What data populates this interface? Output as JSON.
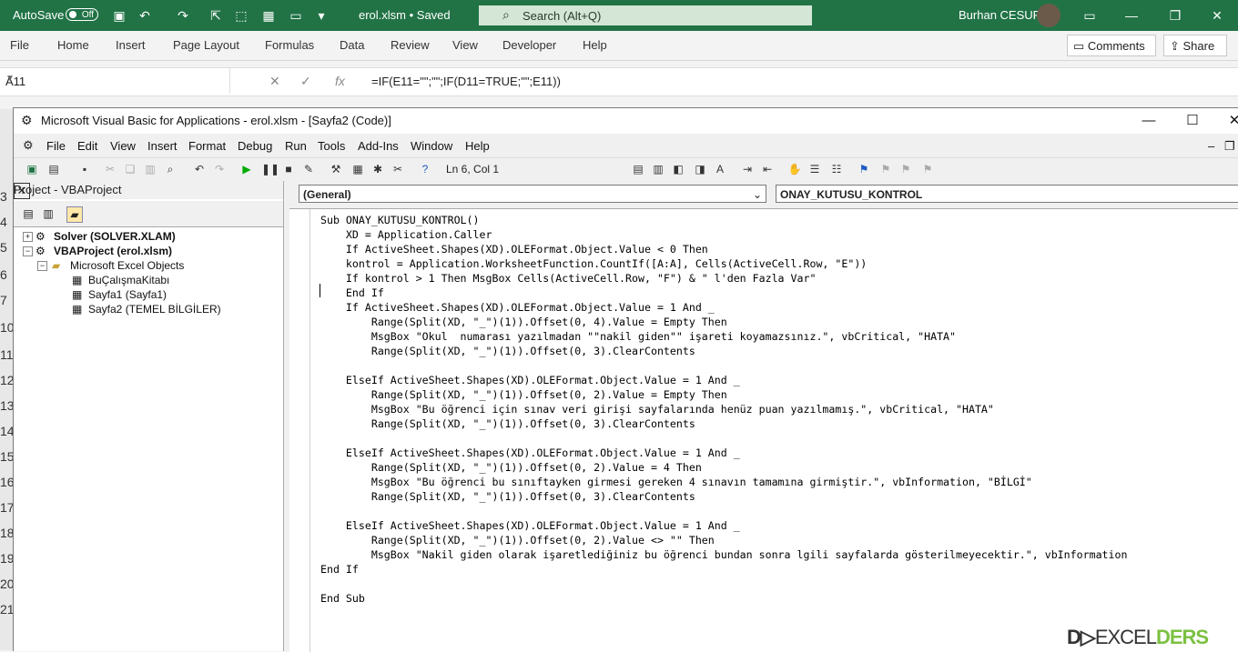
{
  "excel": {
    "autosave_label": "AutoSave",
    "autosave_state": "Off",
    "filename": "erol.xlsm • Saved",
    "search_placeholder": "Search (Alt+Q)",
    "user_name": "Burhan CESUR",
    "ribbon_tabs": [
      "File",
      "Home",
      "Insert",
      "Page Layout",
      "Formulas",
      "Data",
      "Review",
      "View",
      "Developer",
      "Help"
    ],
    "comments_label": "Comments",
    "share_label": "Share",
    "name_box": "A11",
    "formula": "=IF(E11=\"\";\"\";IF(D11=TRUE;\"\";E11))",
    "row_numbers": [
      "3",
      "4",
      "5",
      "6",
      "7",
      "10",
      "11",
      "12",
      "13",
      "14",
      "15",
      "16",
      "17",
      "18",
      "19",
      "20",
      "21"
    ]
  },
  "vba": {
    "title": "Microsoft Visual Basic for Applications - erol.xlsm - [Sayfa2 (Code)]",
    "menu": [
      "File",
      "Edit",
      "View",
      "Insert",
      "Format",
      "Debug",
      "Run",
      "Tools",
      "Add-Ins",
      "Window",
      "Help"
    ],
    "position": "Ln 6, Col 1",
    "project": {
      "header": "Project - VBAProject",
      "items": [
        {
          "label": "Solver (SOLVER.XLAM)"
        },
        {
          "label": "VBAProject (erol.xlsm)"
        },
        {
          "label": "Microsoft Excel Objects"
        },
        {
          "label": "BuÇalışmaKitabı"
        },
        {
          "label": "Sayfa1 (Sayfa1)"
        },
        {
          "label": "Sayfa2 (TEMEL BİLGİLER)"
        }
      ]
    },
    "object_combo": "(General)",
    "proc_combo": "ONAY_KUTUSU_KONTROL",
    "code": "Sub ONAY_KUTUSU_KONTROL()\n    XD = Application.Caller\n    If ActiveSheet.Shapes(XD).OLEFormat.Object.Value < 0 Then\n    kontrol = Application.WorksheetFunction.CountIf([A:A], Cells(ActiveCell.Row, \"E\"))\n    If kontrol > 1 Then MsgBox Cells(ActiveCell.Row, \"F\") & \" l'den Fazla Var\"\n    End If\n    If ActiveSheet.Shapes(XD).OLEFormat.Object.Value = 1 And _\n        Range(Split(XD, \"_\")(1)).Offset(0, 4).Value = Empty Then\n        MsgBox \"Okul  numarası yazılmadan \"\"nakil giden\"\" işareti koyamazsınız.\", vbCritical, \"HATA\"\n        Range(Split(XD, \"_\")(1)).Offset(0, 3).ClearContents\n\n    ElseIf ActiveSheet.Shapes(XD).OLEFormat.Object.Value = 1 And _\n        Range(Split(XD, \"_\")(1)).Offset(0, 2).Value = Empty Then\n        MsgBox \"Bu öğrenci için sınav veri girişi sayfalarında henüz puan yazılmamış.\", vbCritical, \"HATA\"\n        Range(Split(XD, \"_\")(1)).Offset(0, 3).ClearContents\n\n    ElseIf ActiveSheet.Shapes(XD).OLEFormat.Object.Value = 1 And _\n        Range(Split(XD, \"_\")(1)).Offset(0, 2).Value = 4 Then\n        MsgBox \"Bu öğrenci bu sınıftayken girmesi gereken 4 sınavın tamamına girmiştir.\", vbInformation, \"BİLGİ\"\n        Range(Split(XD, \"_\")(1)).Offset(0, 3).ClearContents\n\n    ElseIf ActiveSheet.Shapes(XD).OLEFormat.Object.Value = 1 And _\n        Range(Split(XD, \"_\")(1)).Offset(0, 2).Value <> \"\" Then\n        MsgBox \"Nakil giden olarak işaretlediğiniz bu öğrenci bundan sonra lgili sayfalarda gösterilmeyecektir.\", vbInformation\nEnd If\n\nEnd Sub"
  },
  "colors": {
    "excel_green": "#217346",
    "search_bg": "#d4e6d6"
  }
}
